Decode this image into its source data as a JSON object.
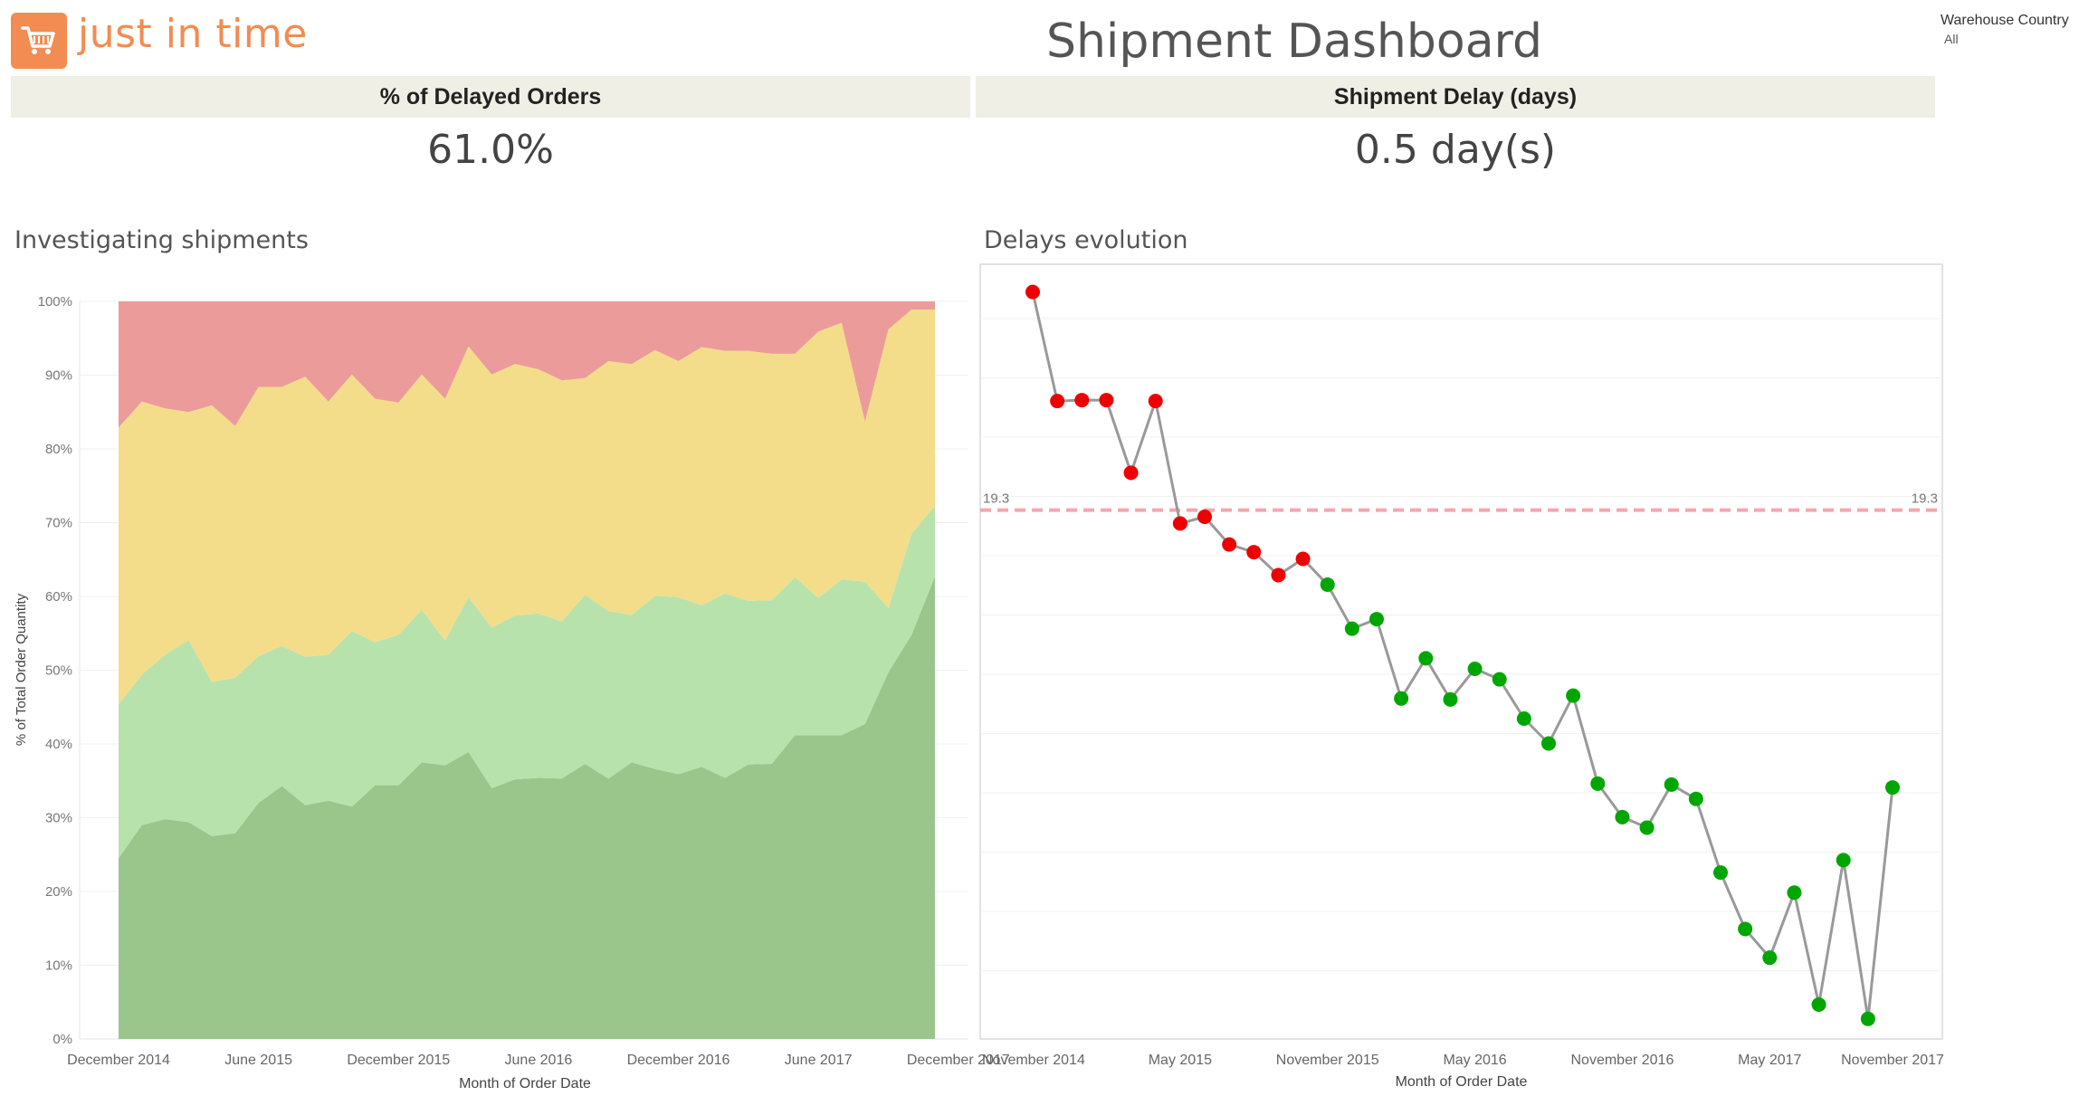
{
  "brand": {
    "name": "just in time",
    "logo_icon": "shopping-cart-icon",
    "accent": "#f28c52"
  },
  "dashboard_title": "Shipment Dashboard",
  "filter": {
    "label": "Warehouse Country",
    "value": "All"
  },
  "kpis": {
    "delayed_orders": {
      "label": "% of Delayed Orders",
      "value": "61.0%"
    },
    "shipment_delay": {
      "label": "Shipment Delay (days)",
      "value": "0.5 day(s)"
    }
  },
  "panels": {
    "left_title": "Investigating shipments",
    "right_title": "Delays evolution"
  },
  "chart_data": [
    {
      "type": "area",
      "stacked": true,
      "normalized": true,
      "xlabel": "Month of Order Date",
      "ylabel": "% of Total Order Quantity",
      "x_start": "2014-12",
      "x_ticks": [
        "December 2014",
        "June 2015",
        "December 2015",
        "June 2016",
        "December 2016",
        "June 2017",
        "December 2017"
      ],
      "y_ticks": [
        "100%",
        "90%",
        "80%",
        "70%",
        "60%",
        "50%",
        "40%",
        "30%",
        "20%",
        "10%",
        "0%"
      ],
      "ylim": [
        0,
        100
      ],
      "colors": [
        "#9ac58b",
        "#b8e2ac",
        "#f3dd8a",
        "#ec9b9b"
      ],
      "boundaries": [
        [
          24.5,
          29,
          29.8,
          29.4,
          27.5,
          27.9,
          32,
          34.3,
          31.7,
          32.3,
          31.5,
          34.4,
          34.4,
          37.5,
          37.1,
          38.9,
          34,
          35.2,
          35.4,
          35.3,
          37.3,
          35.3,
          37.5,
          36.6,
          35.9,
          36.9,
          35.4,
          37.2,
          37.3,
          41.2,
          41.2,
          41.2,
          42.7,
          49.7,
          54.8,
          62.7
        ],
        [
          45.4,
          49.4,
          52.1,
          54.1,
          48.4,
          49,
          51.9,
          53.3,
          51.8,
          52.1,
          55.3,
          53.8,
          54.8,
          58.2,
          54,
          59.9,
          55.8,
          57.4,
          57.7,
          56.6,
          60.2,
          58,
          57.5,
          60.1,
          59.9,
          58.8,
          60.4,
          59.4,
          59.5,
          62.6,
          59.8,
          62.3,
          62,
          58.4,
          68.5,
          72.3
        ],
        [
          82.9,
          86.4,
          85.5,
          85,
          85.9,
          83.1,
          88.4,
          88.4,
          89.8,
          86.4,
          90.1,
          86.8,
          86.3,
          90.1,
          86.8,
          93.9,
          90.1,
          91.5,
          90.8,
          89.3,
          89.6,
          91.9,
          91.5,
          93.4,
          91.9,
          93.8,
          93.3,
          93.3,
          92.9,
          92.9,
          95.9,
          97.1,
          83.7,
          96.2,
          98.9,
          98.9
        ]
      ]
    },
    {
      "type": "line",
      "xlabel": "Month of Order Date",
      "x_start": "2014-11",
      "x_ticks": [
        "November 2014",
        "May 2015",
        "November 2015",
        "May 2016",
        "November 2016",
        "May 2017",
        "November 2017"
      ],
      "reference_line": {
        "value": 19.3,
        "label": "19.3",
        "color": "#f4a6b0"
      },
      "colors": {
        "above": "#ee0000",
        "below": "#00a600",
        "line": "#999999"
      },
      "values": [
        42.1,
        30.7,
        30.8,
        30.8,
        23.2,
        30.7,
        17.9,
        18.6,
        15.7,
        14.9,
        12.5,
        14.2,
        11.5,
        6.9,
        7.9,
        -0.4,
        3.8,
        -0.5,
        2.7,
        1.6,
        -2.5,
        -5.1,
        -0.1,
        -9.3,
        -12.8,
        -13.9,
        -9.4,
        -10.9,
        -18.6,
        -24.5,
        -27.5,
        -20.7,
        -32.4,
        -17.3,
        -33.9,
        -9.7
      ],
      "ylim": [
        -36,
        45
      ]
    }
  ]
}
